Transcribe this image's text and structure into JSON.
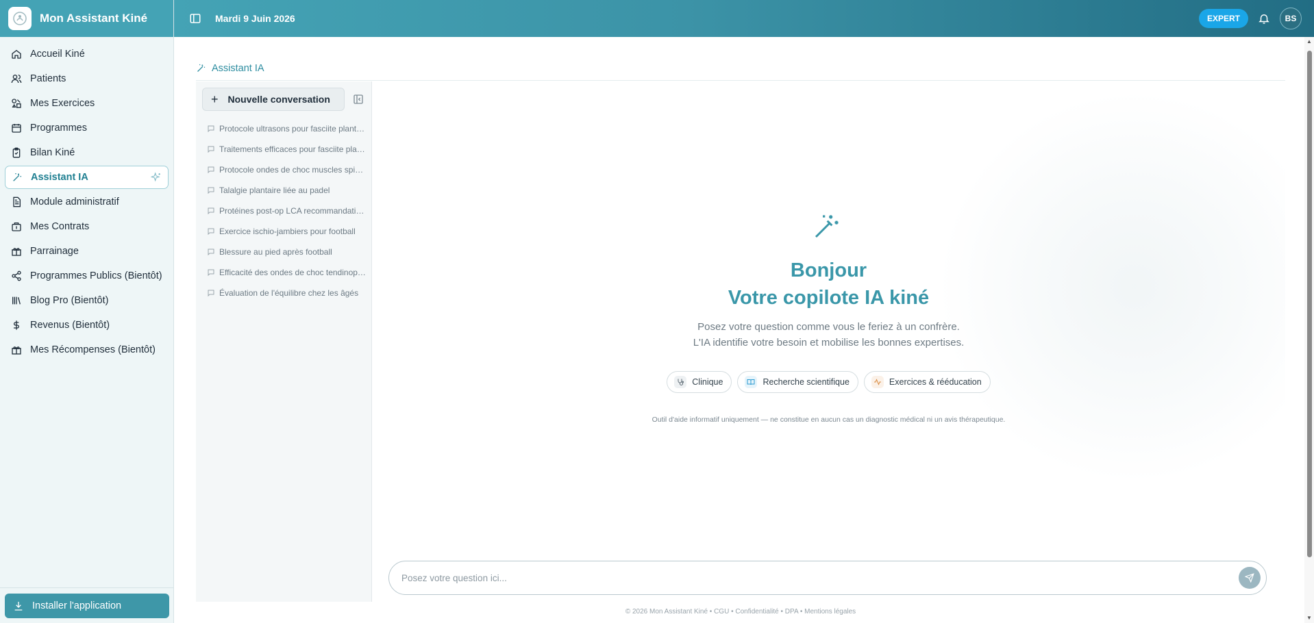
{
  "app": {
    "title": "Mon Assistant Kiné"
  },
  "header": {
    "date": "Mardi 9 Juin 2026",
    "badge": "EXPERT",
    "avatar_initials": "BS"
  },
  "sidebar": {
    "items": [
      {
        "label": "Accueil Kiné",
        "icon": "home-icon"
      },
      {
        "label": "Patients",
        "icon": "users-icon"
      },
      {
        "label": "Mes Exercices",
        "icon": "shapes-icon"
      },
      {
        "label": "Programmes",
        "icon": "calendar-icon"
      },
      {
        "label": "Bilan Kiné",
        "icon": "clipboard-icon"
      },
      {
        "label": "Assistant IA",
        "icon": "wand-icon",
        "active": true
      },
      {
        "label": "Module administratif",
        "icon": "document-icon"
      },
      {
        "label": "Mes Contrats",
        "icon": "briefcase-icon"
      },
      {
        "label": "Parrainage",
        "icon": "gift-icon"
      },
      {
        "label": "Programmes Publics (Bientôt)",
        "icon": "share-icon"
      },
      {
        "label": "Blog Pro (Bientôt)",
        "icon": "library-icon"
      },
      {
        "label": "Revenus (Bientôt)",
        "icon": "dollar-icon"
      },
      {
        "label": "Mes Récompenses (Bientôt)",
        "icon": "gift-icon"
      }
    ],
    "install_label": "Installer l'application"
  },
  "page": {
    "title": "Assistant IA"
  },
  "conversations": {
    "new_label": "Nouvelle conversation",
    "items": [
      "Protocole ultrasons pour fasciite plantaire",
      "Traitements efficaces pour fasciite plantaire",
      "Protocole ondes de choc muscles spinaux",
      "Talalgie plantaire liée au padel",
      "Protéines post-op LCA recommandations",
      "Exercice ischio-jambiers pour football",
      "Blessure au pied après football",
      "Efficacité des ondes de choc tendinopathie",
      "Évaluation de l'équilibre chez les âgés"
    ]
  },
  "welcome": {
    "greeting": "Bonjour",
    "headline": "Votre copilote IA kiné",
    "line1": "Posez votre question comme vous le feriez à un confrère.",
    "line2": "L'IA identifie votre besoin et mobilise les bonnes expertises.",
    "chips": [
      {
        "label": "Clinique",
        "icon": "stethoscope-icon"
      },
      {
        "label": "Recherche scientifique",
        "icon": "book-icon"
      },
      {
        "label": "Exercices & rééducation",
        "icon": "activity-icon"
      }
    ],
    "disclaimer": "Outil d'aide informatif uniquement — ne constitue en aucun cas un diagnostic médical ni un avis thérapeutique."
  },
  "input": {
    "placeholder": "Posez votre question ici..."
  },
  "footer": {
    "text": "© 2026 Mon Assistant Kiné  •  CGU  •  Confidentialité  •  DPA  •  Mentions légales"
  },
  "colors": {
    "brand": "#44a3b5",
    "accent": "#3a97a9",
    "expert_badge": "#1aa6e8"
  }
}
